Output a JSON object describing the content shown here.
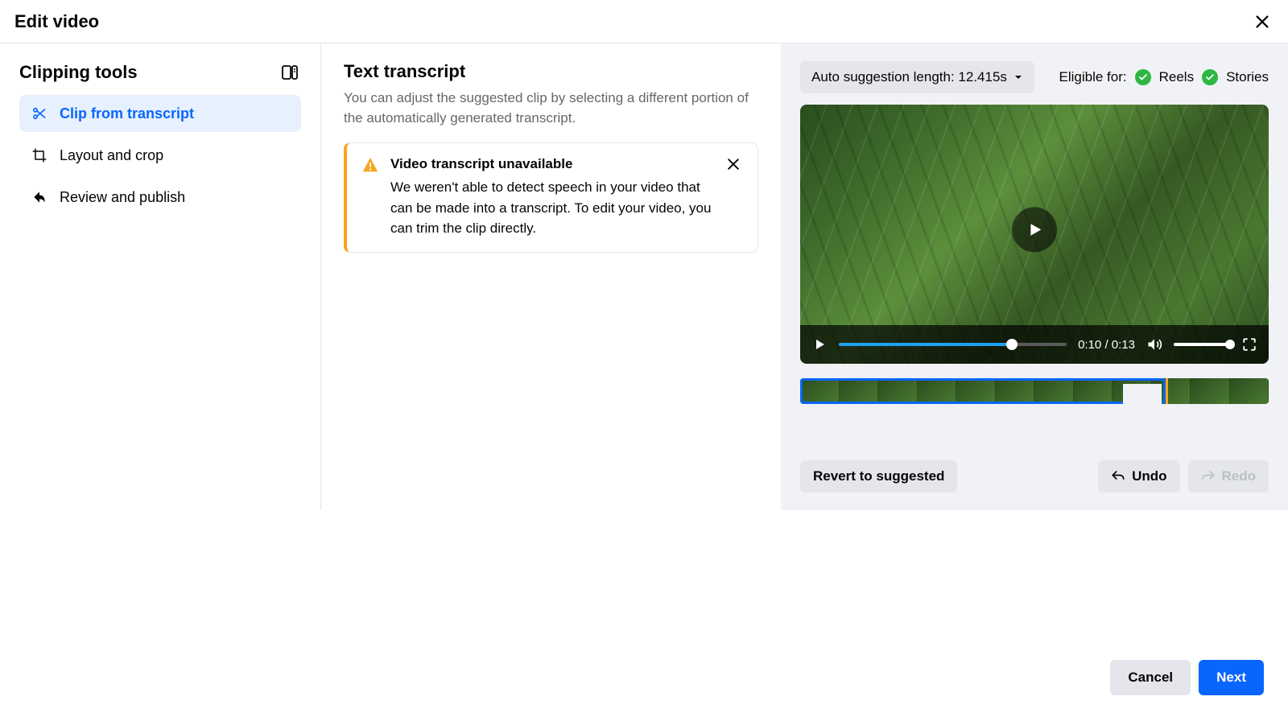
{
  "header": {
    "title": "Edit video"
  },
  "sidebar": {
    "title": "Clipping tools",
    "items": [
      {
        "label": "Clip from transcript",
        "icon": "scissors-icon",
        "active": true
      },
      {
        "label": "Layout and crop",
        "icon": "crop-icon",
        "active": false
      },
      {
        "label": "Review and publish",
        "icon": "share-icon",
        "active": false
      }
    ]
  },
  "transcript": {
    "title": "Text transcript",
    "subtitle": "You can adjust the suggested clip by selecting a different portion of the automatically generated transcript.",
    "alert": {
      "title": "Video transcript unavailable",
      "body": "We weren't able to detect speech in your video that can be made into a transcript. To edit your video, you can trim the clip directly."
    }
  },
  "preview": {
    "suggestion_label": "Auto suggestion length: 12.415s",
    "eligible_label": "Eligible for:",
    "eligible_items": [
      "Reels",
      "Stories"
    ],
    "time_current": "0:10",
    "time_sep": " / ",
    "time_total": "0:13",
    "progress_percent": 76,
    "selection_percent": 78
  },
  "actions": {
    "revert": "Revert to suggested",
    "undo": "Undo",
    "redo": "Redo"
  },
  "footer": {
    "cancel": "Cancel",
    "next": "Next"
  }
}
